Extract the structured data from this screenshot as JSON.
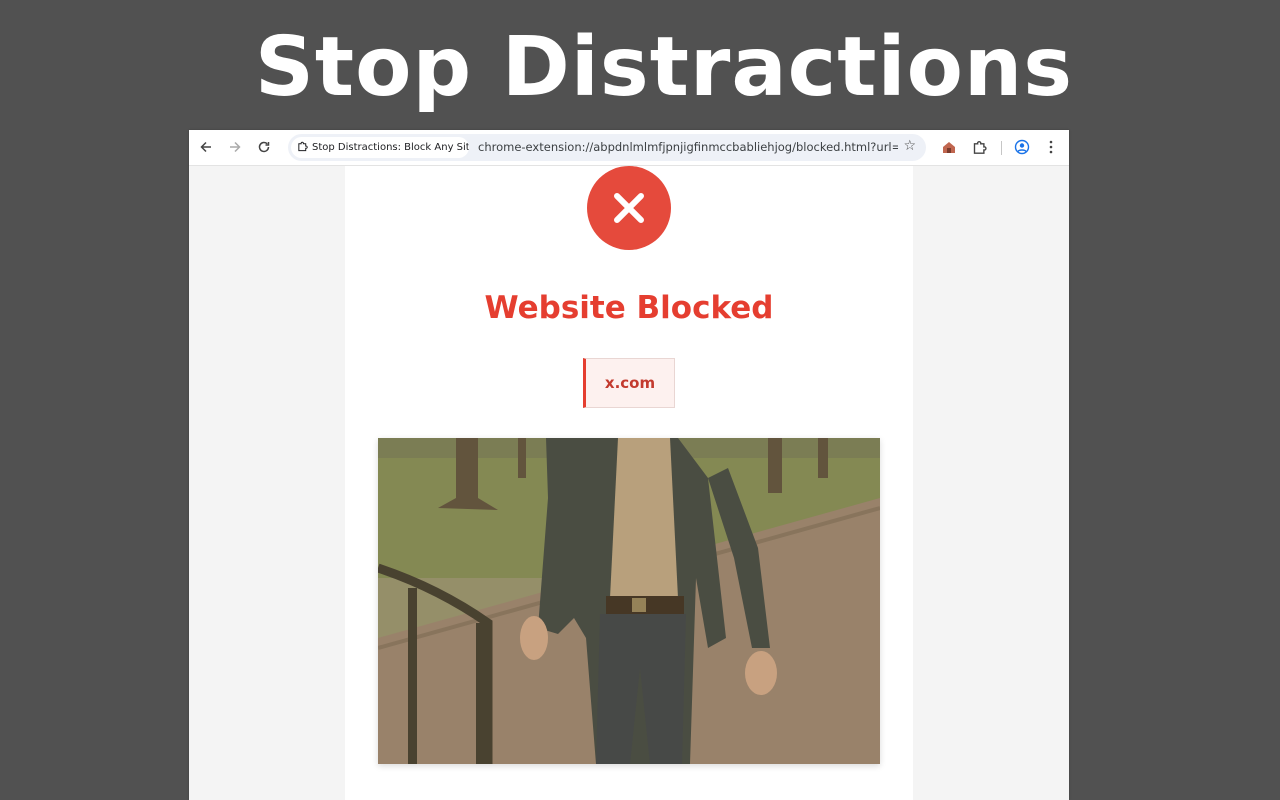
{
  "banner": {
    "title": "Stop Distractions"
  },
  "browser": {
    "tab_chip_label": "Stop Distractions: Block Any Site",
    "url": "chrome-extension://abpdnlmlmfjpnjigfinmccbabliehjog/blocked.html?url=ht...",
    "icons": [
      "back-arrow-icon",
      "forward-arrow-icon",
      "reload-icon",
      "puzzle-icon",
      "star-icon",
      "extension-icon",
      "profile-icon",
      "more-vert-icon"
    ]
  },
  "blocked_page": {
    "title": "Website Blocked",
    "domain": "x.com",
    "photo_description_icon": "man-in-suit-walking-photo"
  },
  "colors": {
    "background": "#515151",
    "accent_red": "#e53e30",
    "circle_red": "#e54a3c",
    "domain_bg": "#fdf1ef"
  }
}
